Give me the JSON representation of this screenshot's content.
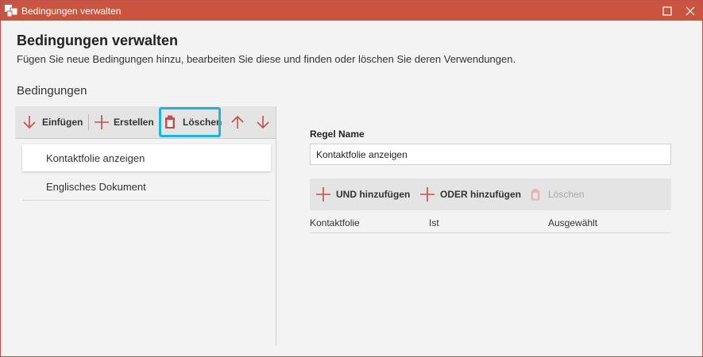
{
  "window": {
    "title": "Bedingungen verwalten"
  },
  "header": {
    "title": "Bedingungen verwalten",
    "subtitle": "Fügen Sie neue Bedingungen hinzu, bearbeiten Sie diese und finden oder löschen Sie deren Verwendungen."
  },
  "conditions": {
    "section_label": "Bedingungen",
    "toolbar": {
      "insert": "Einfügen",
      "create": "Erstellen",
      "delete": "Löschen"
    },
    "items": [
      {
        "label": "Kontaktfolie anzeigen",
        "selected": true
      },
      {
        "label": "Englisches Dokument",
        "selected": false
      }
    ]
  },
  "rule": {
    "name_label": "Regel Name",
    "name_value": "Kontaktfolie anzeigen",
    "toolbar": {
      "add_and": "UND hinzufügen",
      "add_or": "ODER hinzufügen",
      "delete": "Löschen"
    },
    "table": {
      "columns": [
        "Kontaktfolie",
        "Ist",
        "Ausgewählt"
      ]
    }
  },
  "colors": {
    "titlebar": "#c9553e",
    "accent_icon": "#c0504d",
    "highlight": "#1eb4dc"
  },
  "icons": [
    "app-icon",
    "maximize-icon",
    "close-icon",
    "arrow-down-icon",
    "plus-icon",
    "trash-icon",
    "arrow-up-icon"
  ]
}
